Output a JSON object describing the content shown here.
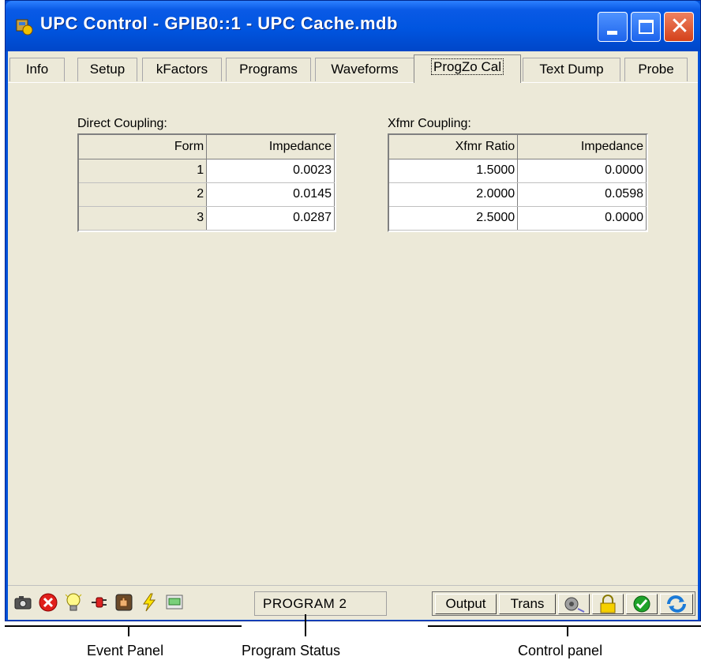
{
  "window": {
    "title": "UPC Control - GPIB0::1 - UPC Cache.mdb"
  },
  "tabs": [
    {
      "label": "Info"
    },
    {
      "label": "Setup"
    },
    {
      "label": "kFactors"
    },
    {
      "label": "Programs"
    },
    {
      "label": "Waveforms"
    },
    {
      "label": "ProgZo Cal",
      "active": true
    },
    {
      "label": "Text Dump"
    },
    {
      "label": "Probe"
    }
  ],
  "direct_coupling": {
    "label": "Direct Coupling:",
    "headers": [
      "Form",
      "Impedance"
    ],
    "rows": [
      {
        "form": "1",
        "impedance": "0.0023"
      },
      {
        "form": "2",
        "impedance": "0.0145"
      },
      {
        "form": "3",
        "impedance": "0.0287"
      }
    ]
  },
  "xfmr_coupling": {
    "label": "Xfmr Coupling:",
    "headers": [
      "Xfmr Ratio",
      "Impedance"
    ],
    "rows": [
      {
        "ratio": "1.5000",
        "impedance": "0.0000"
      },
      {
        "ratio": "2.0000",
        "impedance": "0.0598"
      },
      {
        "ratio": "2.5000",
        "impedance": "0.0000"
      }
    ]
  },
  "status_bar": {
    "event_icons": [
      "camera-icon",
      "error-icon",
      "lightbulb-icon",
      "plug-icon",
      "hand-icon",
      "lightning-icon",
      "display-icon"
    ],
    "program_status": "PROGRAM 2",
    "controls": {
      "output_label": "Output",
      "trans_label": "Trans",
      "icons": [
        "speaker-icon",
        "lock-icon",
        "check-icon",
        "refresh-icon"
      ]
    }
  },
  "annotations": {
    "event_panel": "Event Panel",
    "program_status": "Program  Status",
    "control_panel": "Control panel"
  },
  "colors": {
    "titlebar": "#0055e0",
    "client_bg": "#ece9d8",
    "close_button": "#d4411a"
  }
}
